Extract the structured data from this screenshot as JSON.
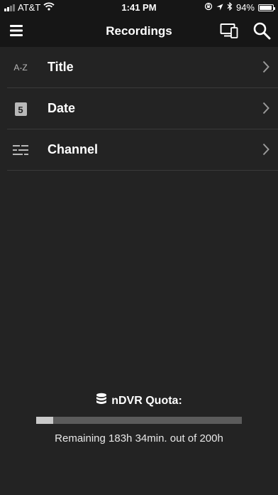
{
  "status_bar": {
    "carrier": "AT&T",
    "time": "1:41 PM",
    "battery": "94%",
    "battery_level": 0.94,
    "icons": [
      "signal-icon",
      "wifi-icon",
      "lock-rotation-icon",
      "location-icon",
      "bluetooth-icon",
      "battery-icon"
    ]
  },
  "header": {
    "title": "Recordings",
    "icons": [
      "menu-icon",
      "devices-icon",
      "search-icon"
    ]
  },
  "sort_options": [
    {
      "label": "Title",
      "icon": "az-sort-icon",
      "icon_text": "A-Z"
    },
    {
      "label": "Date",
      "icon": "calendar-icon",
      "icon_text": "5"
    },
    {
      "label": "Channel",
      "icon": "channel-list-icon"
    }
  ],
  "quota": {
    "title": "nDVR Quota:",
    "icon": "database-icon",
    "remaining_text": "Remaining 183h 34min. out of 200h",
    "used_fraction": 0.083
  },
  "colors": {
    "background": "#232323",
    "bar_background": "#161616",
    "text": "#ffffff",
    "icon_gray": "#b8b8b8",
    "separator": "#3a3a3a",
    "progress_track": "#5b5b5b",
    "progress_fill": "#c9c9c9"
  }
}
